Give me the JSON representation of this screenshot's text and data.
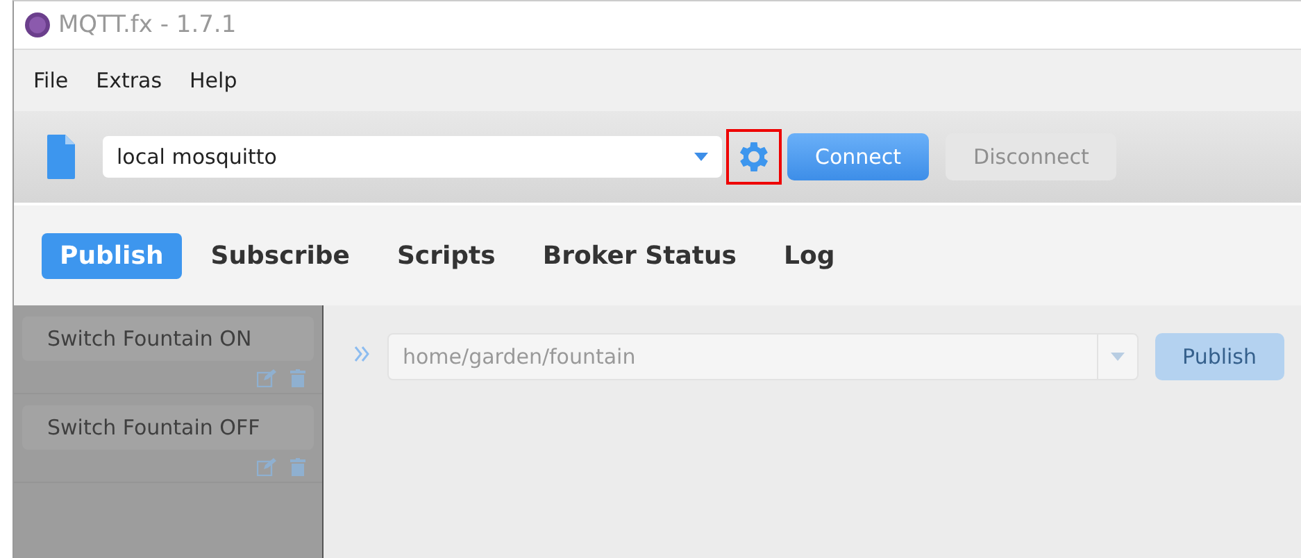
{
  "window": {
    "title": "MQTT.fx - 1.7.1"
  },
  "menu": [
    "File",
    "Extras",
    "Help"
  ],
  "toolbar": {
    "profile": "local mosquitto",
    "settings_highlighted": true,
    "buttons": [
      {
        "label": "Connect",
        "disabled": false
      },
      {
        "label": "Disconnect",
        "disabled": true
      }
    ]
  },
  "tabs": [
    {
      "label": "Publish",
      "selected": true
    },
    {
      "label": "Subscribe",
      "selected": false
    },
    {
      "label": "Scripts",
      "selected": false
    },
    {
      "label": "Broker Status",
      "selected": false
    },
    {
      "label": "Log",
      "selected": false
    }
  ],
  "sidebar": {
    "disabled": true,
    "items": [
      {
        "label": "Switch Fountain ON"
      },
      {
        "label": "Switch Fountain OFF"
      }
    ]
  },
  "publish": {
    "topic": "home/garden/fountain",
    "button": {
      "label": "Publish",
      "disabled": true
    }
  }
}
